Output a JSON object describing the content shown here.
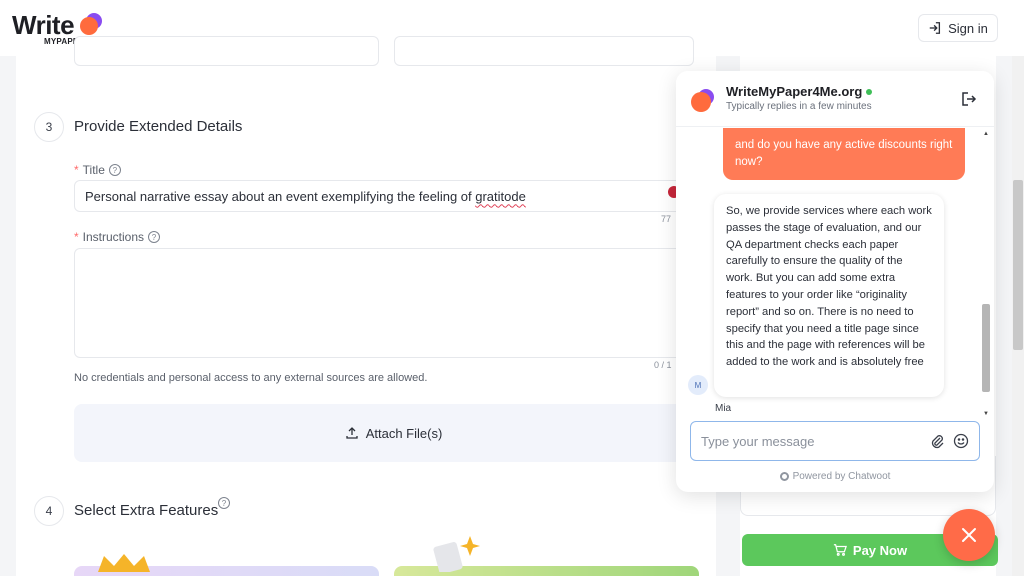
{
  "header": {
    "logo_text": "Write",
    "logo_sub": "MYPAPER4ME",
    "signin_label": "Sign in"
  },
  "form": {
    "step3": {
      "number": "3",
      "title": "Provide Extended Details"
    },
    "title_field": {
      "label": "Title",
      "value_prefix": "Personal narrative essay about an event exemplifying the feeling of ",
      "value_typo": "gratitode",
      "counter": "77"
    },
    "instructions_field": {
      "label": "Instructions",
      "counter": "0 / 1"
    },
    "note": "No credentials and personal access to any external sources are allowed.",
    "attach_label": "Attach File(s)",
    "step4": {
      "number": "4",
      "title": "Select Extra Features"
    }
  },
  "summary": {
    "pay_label": "Pay Now"
  },
  "chat": {
    "name": "WriteMyPaper4Me.org",
    "status": "Typically replies in a few minutes",
    "outgoing": "and do you have any active discounts right now?",
    "incoming": "So, we provide services where each work passes the stage of evaluation, and our QA department checks each paper carefully to ensure the quality of the work. But you can add some extra features to your order like “originality report” and so on. There is no need to specify that you need a title page since this and the page with references will be added to the work and is absolutely free",
    "agent_initial": "M",
    "agent_name": "Mia",
    "input_placeholder": "Type your message",
    "powered_by": "Powered by Chatwoot"
  },
  "colors": {
    "accent": "#ff7b56",
    "pay": "#5cc85c",
    "online": "#3fbf58"
  }
}
